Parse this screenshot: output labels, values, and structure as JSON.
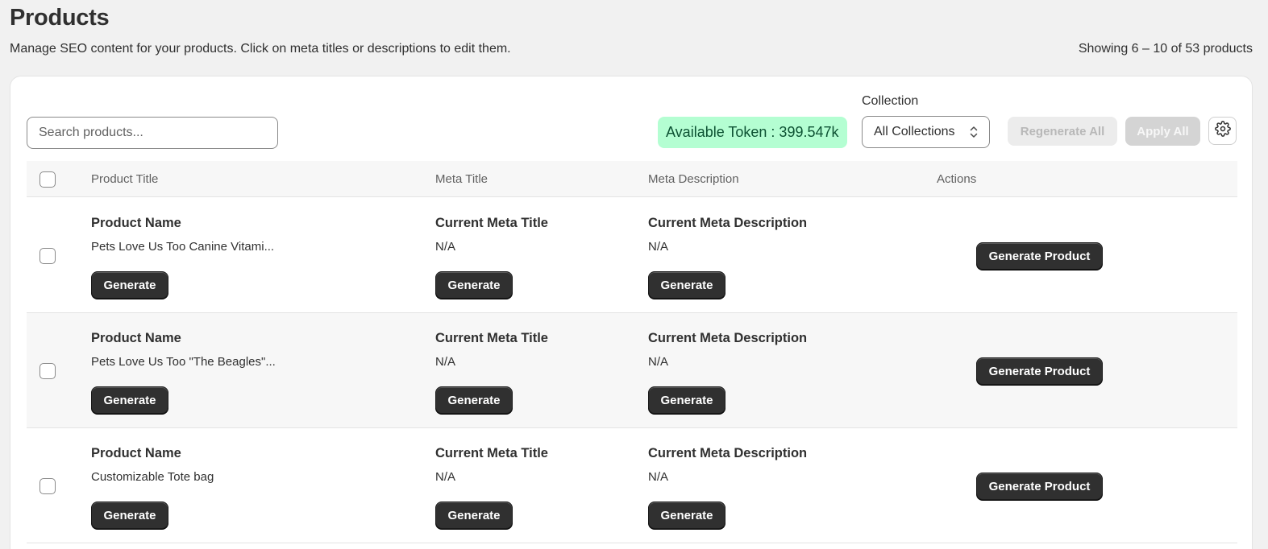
{
  "header": {
    "title": "Products",
    "subtitle": "Manage SEO content for your products. Click on meta titles or descriptions to edit them.",
    "showing": "Showing 6 – 10 of 53 products"
  },
  "toolbar": {
    "search_placeholder": "Search products...",
    "token": "Available Token : 399.547k",
    "collection_label": "Collection",
    "collection_value": "All Collections",
    "regenerate_all": "Regenerate All",
    "apply_all": "Apply All",
    "settings_icon": "gear-icon"
  },
  "table": {
    "columns": [
      "Product Title",
      "Meta Title",
      "Meta Description",
      "Actions"
    ],
    "rows": [
      {
        "product_label": "Product Name",
        "product_value": "Pets Love Us Too Canine Vitami...",
        "meta_title_label": "Current Meta Title",
        "meta_title_value": "N/A",
        "meta_desc_label": "Current Meta Description",
        "meta_desc_value": "N/A",
        "generate": "Generate",
        "generate_product": "Generate Product"
      },
      {
        "product_label": "Product Name",
        "product_value": "Pets Love Us Too \"The Beagles\"...",
        "meta_title_label": "Current Meta Title",
        "meta_title_value": "N/A",
        "meta_desc_label": "Current Meta Description",
        "meta_desc_value": "N/A",
        "generate": "Generate",
        "generate_product": "Generate Product"
      },
      {
        "product_label": "Product Name",
        "product_value": "Customizable Tote bag",
        "meta_title_label": "Current Meta Title",
        "meta_title_value": "N/A",
        "meta_desc_label": "Current Meta Description",
        "meta_desc_value": "N/A",
        "generate": "Generate",
        "generate_product": "Generate Product"
      }
    ]
  },
  "colors": {
    "background": "#f1f1f1",
    "card": "#ffffff",
    "token_bg": "#b4fed2",
    "token_text": "#0c5132",
    "button_dark": "#303030"
  }
}
